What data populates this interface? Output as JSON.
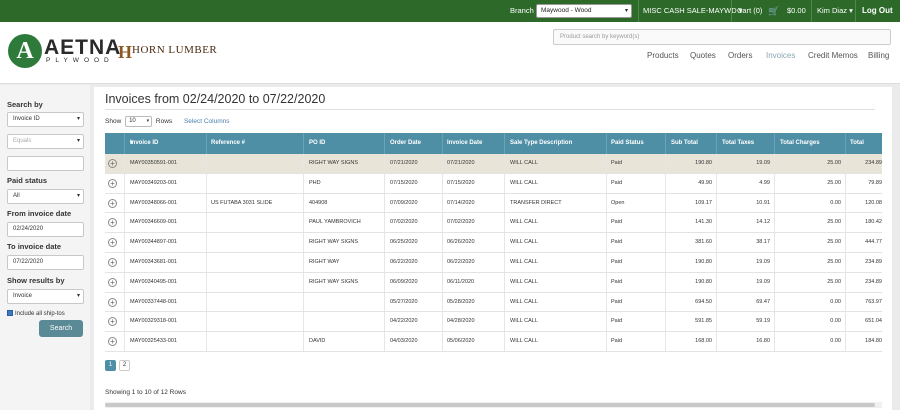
{
  "topbar": {
    "branch_label": "Branch",
    "branch_value": "Maywood - Wood",
    "account": "MISC CASH SALE-MAYWD",
    "cart_label": "Cart (0)",
    "cart_total": "$0.00",
    "user": "Kim Diaz",
    "logout": "Log Out",
    "cart_icon": "cart-icon"
  },
  "header": {
    "logo_letter": "A",
    "logo_name": "AETNA",
    "logo_sub": "PLYWOOD",
    "partner_mark": "H",
    "partner_name": "HORN LUMBER",
    "search_placeholder": "Product search by keyword(s)",
    "nav": [
      "Products",
      "Quotes",
      "Orders",
      "Invoices",
      "Credit Memos",
      "Billing"
    ]
  },
  "sidebar": {
    "search_by_label": "Search by",
    "search_by_value": "Invoice ID",
    "operator_value": "Equals",
    "search_value": "",
    "paid_status_label": "Paid status",
    "paid_status_value": "All",
    "from_label": "From invoice date",
    "from_value": "02/24/2020",
    "to_label": "To invoice date",
    "to_value": "07/22/2020",
    "show_results_label": "Show results by",
    "show_results_value": "Invoice",
    "include_label": "Include all ship-tos",
    "search_button": "Search"
  },
  "main": {
    "title": "Invoices from 02/24/2020 to 07/22/2020",
    "show_label": "Show",
    "show_value": "10",
    "rows_label": "Rows",
    "select_columns": "Select Columns",
    "columns": [
      "Invoice ID",
      "Reference #",
      "PO ID",
      "Order Date",
      "Invoice Date",
      "Sale Type Description",
      "Paid Status",
      "Sub Total",
      "Total Taxes",
      "Total Charges",
      "Total"
    ],
    "sort_icon": "sort-down-icon",
    "rows": [
      {
        "id": "MAY00350591-001",
        "ref": "",
        "po": "RIGHT WAY SIGNS",
        "order": "07/21/2020",
        "invoice": "07/21/2020",
        "sale": "WILL CALL",
        "paid": "Paid",
        "sub": "190.80",
        "tax": "19.09",
        "charges": "25.00",
        "total": "234.89"
      },
      {
        "id": "MAY00349203-001",
        "ref": "",
        "po": "PHD",
        "order": "07/15/2020",
        "invoice": "07/15/2020",
        "sale": "WILL CALL",
        "paid": "Paid",
        "sub": "49.90",
        "tax": "4.99",
        "charges": "25.00",
        "total": "79.89"
      },
      {
        "id": "MAY00348066-001",
        "ref": "US FUTABA 3031 SLIDE",
        "po": "404908",
        "order": "07/09/2020",
        "invoice": "07/14/2020",
        "sale": "TRANSFER DIRECT",
        "paid": "Open",
        "sub": "109.17",
        "tax": "10.91",
        "charges": "0.00",
        "total": "120.08"
      },
      {
        "id": "MAY00346609-001",
        "ref": "",
        "po": "PAUL YAMBROVICH",
        "order": "07/02/2020",
        "invoice": "07/02/2020",
        "sale": "WILL CALL",
        "paid": "Paid",
        "sub": "141.30",
        "tax": "14.12",
        "charges": "25.00",
        "total": "180.42"
      },
      {
        "id": "MAY00344897-001",
        "ref": "",
        "po": "RIGHT WAY SIGNS",
        "order": "06/25/2020",
        "invoice": "06/26/2020",
        "sale": "WILL CALL",
        "paid": "Paid",
        "sub": "381.60",
        "tax": "38.17",
        "charges": "25.00",
        "total": "444.77"
      },
      {
        "id": "MAY00343681-001",
        "ref": "",
        "po": "RIGHT WAY",
        "order": "06/22/2020",
        "invoice": "06/22/2020",
        "sale": "WILL CALL",
        "paid": "Paid",
        "sub": "190.80",
        "tax": "19.09",
        "charges": "25.00",
        "total": "234.89"
      },
      {
        "id": "MAY00340495-001",
        "ref": "",
        "po": "RIGHT WAY SIGNS",
        "order": "06/09/2020",
        "invoice": "06/11/2020",
        "sale": "WILL CALL",
        "paid": "Paid",
        "sub": "190.80",
        "tax": "19.09",
        "charges": "25.00",
        "total": "234.89"
      },
      {
        "id": "MAY00337448-001",
        "ref": "",
        "po": "",
        "order": "05/27/2020",
        "invoice": "05/28/2020",
        "sale": "WILL CALL",
        "paid": "Paid",
        "sub": "694.50",
        "tax": "69.47",
        "charges": "0.00",
        "total": "763.97"
      },
      {
        "id": "MAY00329318-001",
        "ref": "",
        "po": "",
        "order": "04/22/2020",
        "invoice": "04/28/2020",
        "sale": "WILL CALL",
        "paid": "Paid",
        "sub": "591.85",
        "tax": "59.19",
        "charges": "0.00",
        "total": "651.04"
      },
      {
        "id": "MAY00325433-001",
        "ref": "",
        "po": "DAVID",
        "order": "04/03/2020",
        "invoice": "05/06/2020",
        "sale": "WILL CALL",
        "paid": "Paid",
        "sub": "168.00",
        "tax": "16.80",
        "charges": "0.00",
        "total": "184.80"
      }
    ],
    "pages": [
      "1",
      "2"
    ],
    "showing": "Showing 1 to 10 of 12 Rows"
  }
}
